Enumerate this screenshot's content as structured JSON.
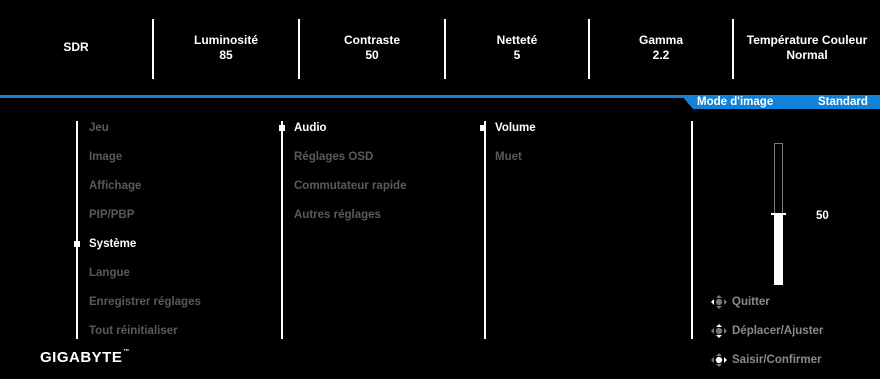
{
  "top_stats": [
    {
      "key": "SDR",
      "value": ""
    },
    {
      "key": "Luminosité",
      "value": "85"
    },
    {
      "key": "Contraste",
      "value": "50"
    },
    {
      "key": "Netteté",
      "value": "5"
    },
    {
      "key": "Gamma",
      "value": "2.2"
    },
    {
      "key": "Température Couleur",
      "value": "Normal"
    }
  ],
  "mode_tab": {
    "label": "Mode d'image",
    "value": "Standard"
  },
  "menu": {
    "col1": [
      "Jeu",
      "Image",
      "Affichage",
      "PIP/PBP",
      "Système",
      "Langue",
      "Enregistrer réglages",
      "Tout réinitialiser"
    ],
    "col1_selected_index": 4,
    "col2": [
      "Audio",
      "Réglages OSD",
      "Commutateur rapide",
      "Autres réglages"
    ],
    "col2_selected_index": 0,
    "col3": [
      "Volume",
      "Muet"
    ],
    "col3_selected_index": 0
  },
  "slider": {
    "value": "50",
    "fraction": 0.5
  },
  "hints": [
    "Quitter",
    "Déplacer/Ajuster",
    "Saisir/Confirmer"
  ],
  "logo": {
    "text": "GIGABYTE",
    "tm": "™"
  },
  "colors": {
    "accent": "#1282d8",
    "dim_text": "#5a5a5a",
    "hint_text": "#8a8a8a"
  }
}
